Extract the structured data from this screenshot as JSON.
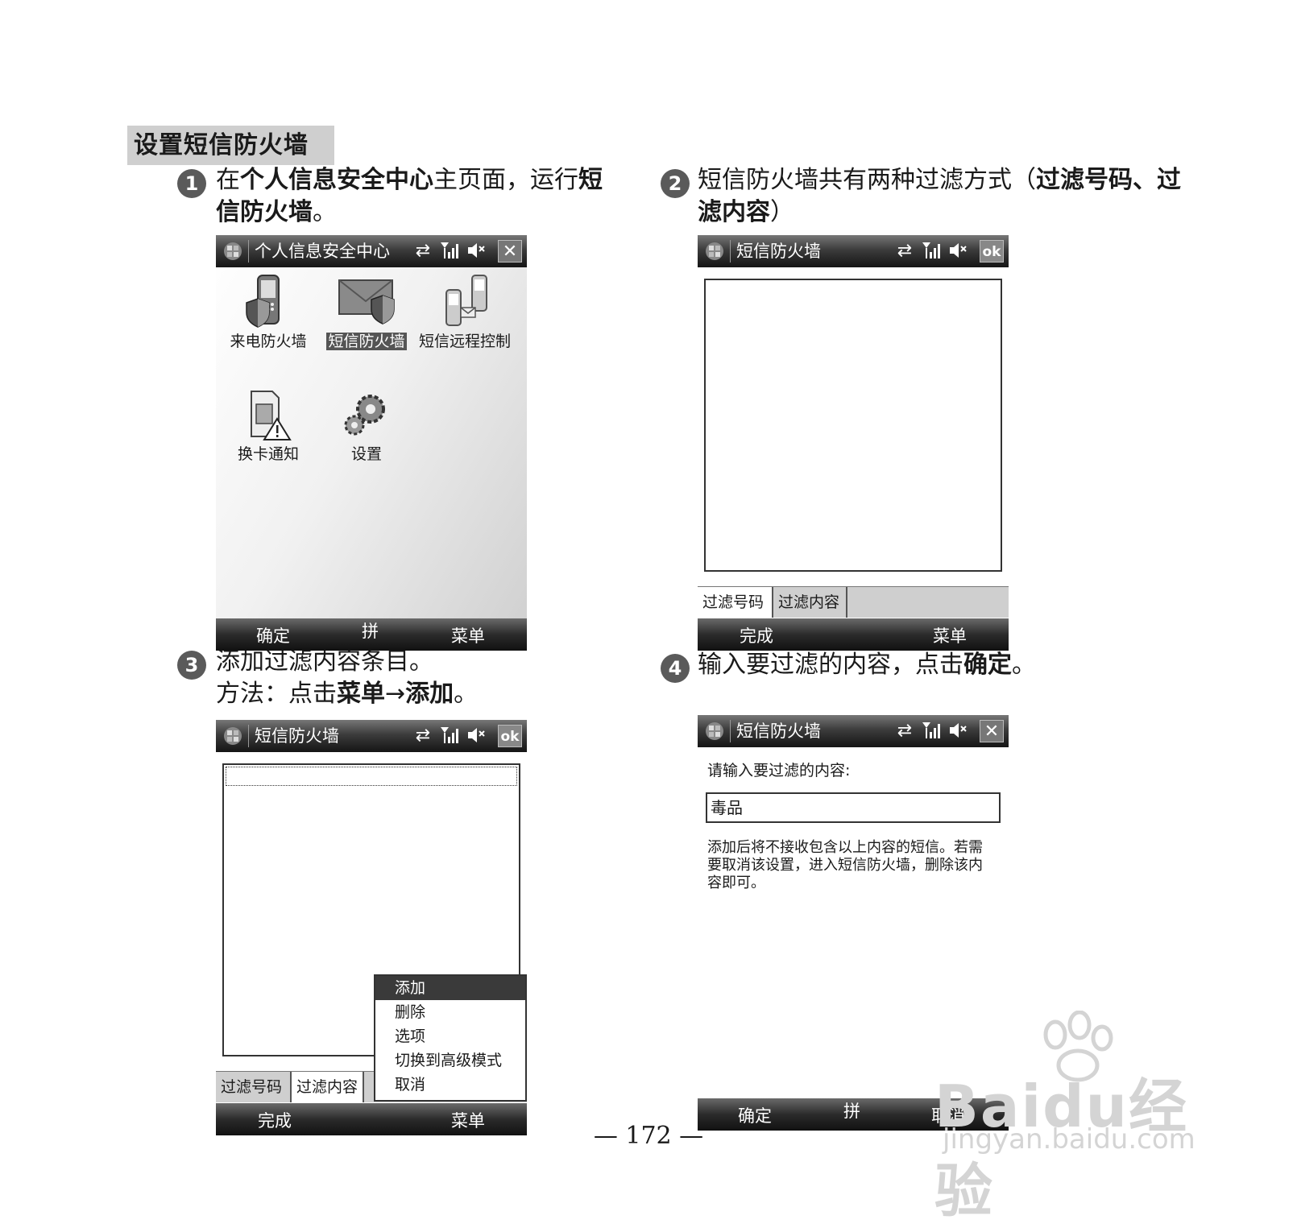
{
  "section_title": "设置短信防火墙",
  "steps": [
    {
      "num": "1",
      "parts": [
        {
          "t": "在",
          "b": false
        },
        {
          "t": "个人信息安全中心",
          "b": true
        },
        {
          "t": "主页面，运行",
          "b": false
        },
        {
          "t": "短信防火墙",
          "b": true
        },
        {
          "t": "。",
          "b": false
        }
      ]
    },
    {
      "num": "2",
      "parts": [
        {
          "t": "短信防火墙共有两种过滤方式（",
          "b": false
        },
        {
          "t": "过滤号码、过滤内容",
          "b": true
        },
        {
          "t": "）",
          "b": false
        }
      ]
    },
    {
      "num": "3",
      "line1": "添加过滤内容条目。",
      "line2_parts": [
        {
          "t": "方法：点击",
          "b": false
        },
        {
          "t": "菜单",
          "b": true
        },
        {
          "t": "→",
          "b": false
        },
        {
          "t": "添加",
          "b": true
        },
        {
          "t": "。",
          "b": false
        }
      ]
    },
    {
      "num": "4",
      "parts": [
        {
          "t": "输入要过滤的内容，点击",
          "b": false
        },
        {
          "t": "确定",
          "b": true
        },
        {
          "t": "。",
          "b": false
        }
      ]
    }
  ],
  "screen1": {
    "title": "个人信息安全中心",
    "icons": [
      {
        "label": "来电防火墙",
        "icon": "phone-shield-icon"
      },
      {
        "label": "短信防火墙",
        "icon": "envelope-shield-icon"
      },
      {
        "label": "短信远程控制",
        "icon": "remote-control-icon"
      },
      {
        "label": "换卡通知",
        "icon": "sim-warning-icon"
      },
      {
        "label": "设置",
        "icon": "gears-icon"
      }
    ],
    "soft_left": "确定",
    "soft_mid": "拼",
    "soft_right": "菜单"
  },
  "screen2": {
    "title": "短信防火墙",
    "tabs": [
      "过滤号码",
      "过滤内容"
    ],
    "soft_left": "完成",
    "soft_right": "菜单",
    "ok_label": "ok"
  },
  "screen3": {
    "title": "短信防火墙",
    "tabs": [
      "过滤号码",
      "过滤内容"
    ],
    "menu_items": [
      "添加",
      "删除",
      "选项",
      "切换到高级模式",
      "取消"
    ],
    "soft_left": "完成",
    "soft_right": "菜单",
    "ok_label": "ok"
  },
  "screen4": {
    "title": "短信防火墙",
    "prompt": "请输入要过滤的内容:",
    "input_value": "毒品",
    "note": "添加后将不接收包含以上内容的短信。若需要取消该设置，进入短信防火墙，删除该内容即可。",
    "soft_left": "确定",
    "soft_mid": "拼",
    "soft_right": "取消"
  },
  "page_number": "— 172 —",
  "watermark": {
    "brand": "Baidu经验",
    "url": "jingyan.baidu.com"
  }
}
